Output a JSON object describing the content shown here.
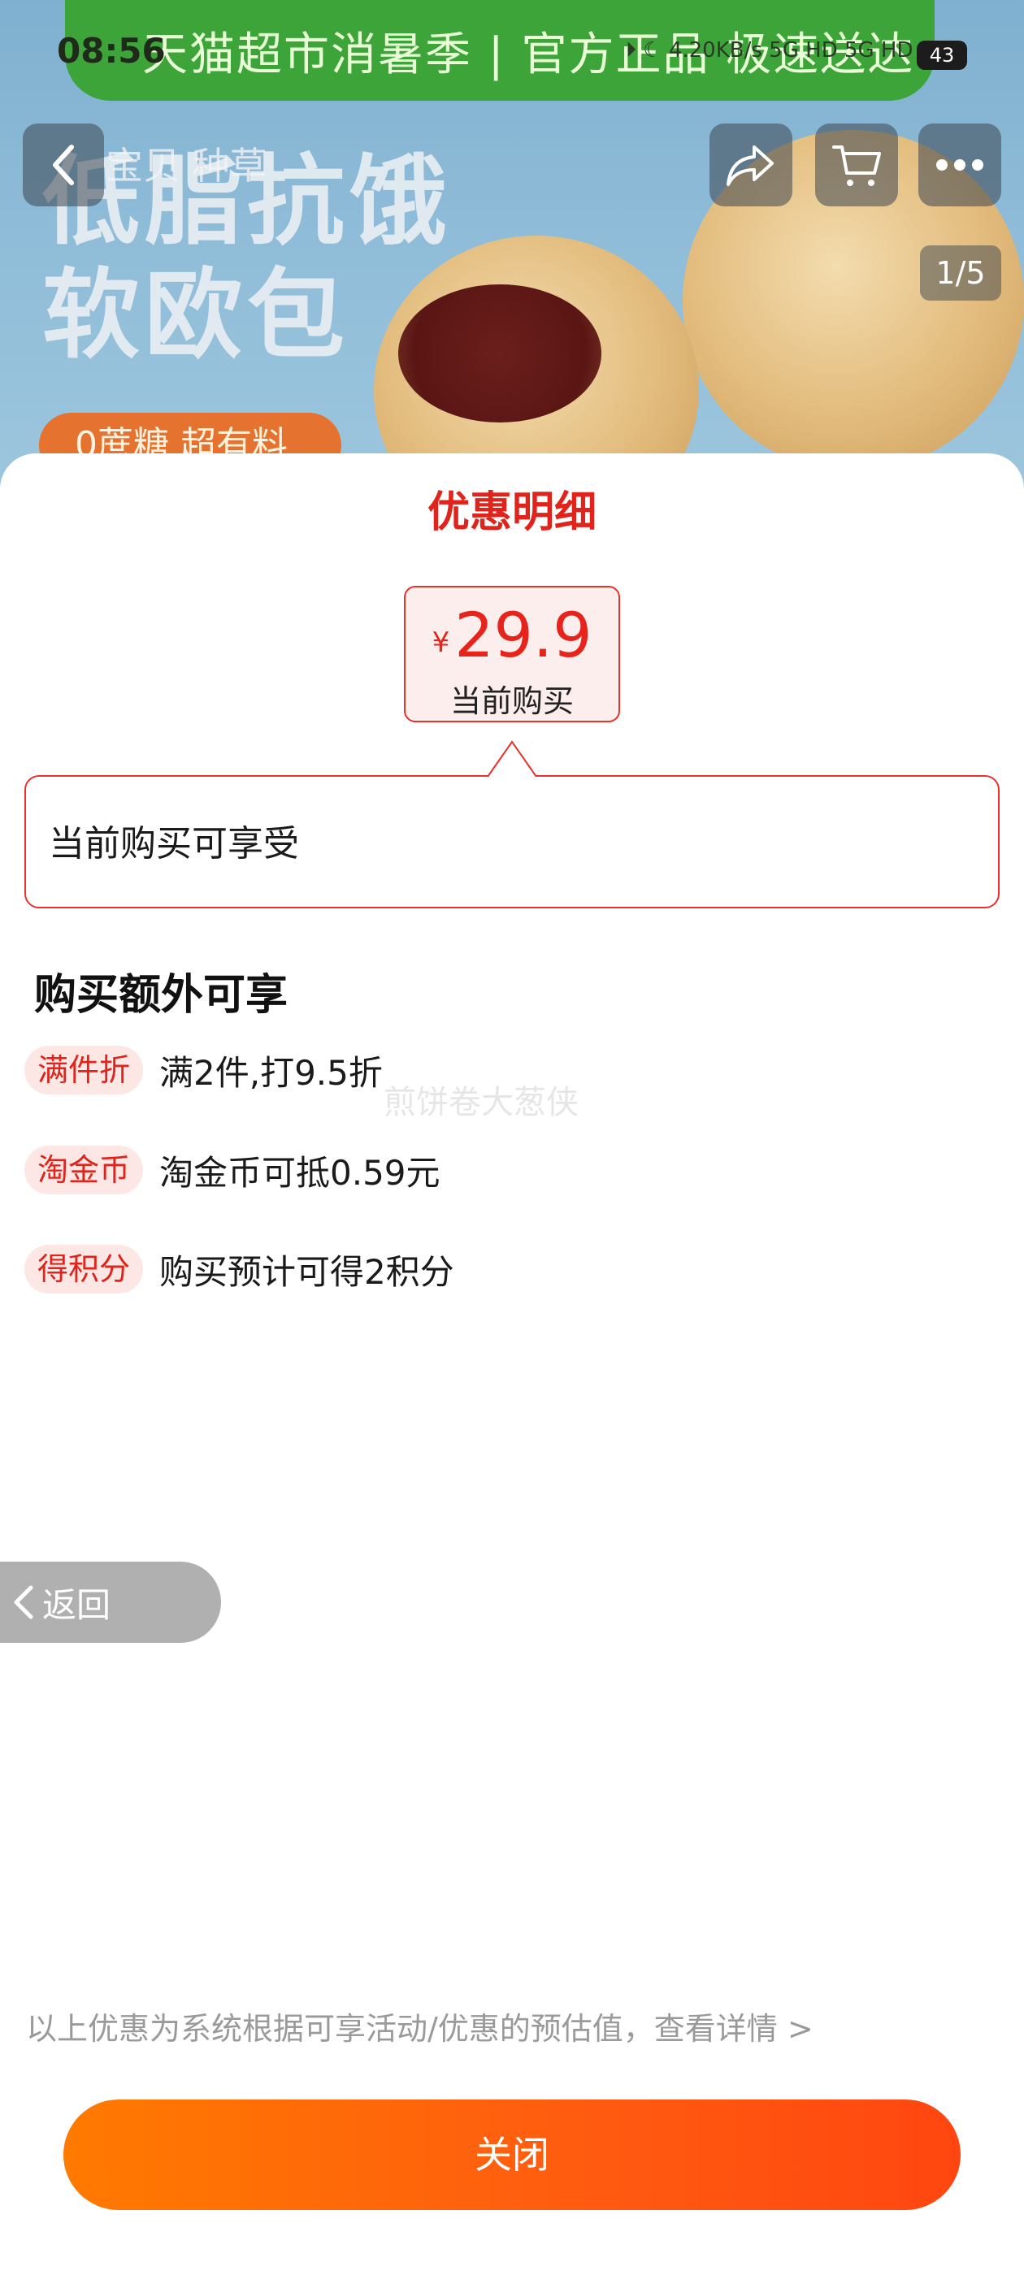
{
  "status_bar": {
    "time": "08:56",
    "icons": "⏵ ☾  4.20KB/s  5G HD  5G HD  ᯤ",
    "battery": "43"
  },
  "background": {
    "promo_strip": "天猫超市消暑季 | 官方正品 极速送达",
    "headline_1": "低脂抗饿",
    "headline_2": "软欧包",
    "tag": "0蔗糖 超有料",
    "breadcrumb": "宝贝  种草",
    "pager": "1/5"
  },
  "sheet": {
    "title": "优惠明细",
    "price": {
      "symbol": "¥",
      "value": "29.9",
      "label": "当前购买"
    },
    "current_benefits_text": "当前购买可享受",
    "extra_title": "购买额外可享",
    "benefits": [
      {
        "tag": "满件折",
        "text": "满2件,打9.5折"
      },
      {
        "tag": "淘金币",
        "text": "淘金币可抵0.59元"
      },
      {
        "tag": "得积分",
        "text": "购买预计可得2积分"
      }
    ],
    "watermark": "煎饼卷大葱侠",
    "back_label": "返回",
    "disclaimer": "以上优惠为系统根据可享活动/优惠的预估值，查看详情 >",
    "close_label": "关闭"
  },
  "colors": {
    "accent_red": "#e0231b",
    "button_orange": "#ff6a00"
  }
}
